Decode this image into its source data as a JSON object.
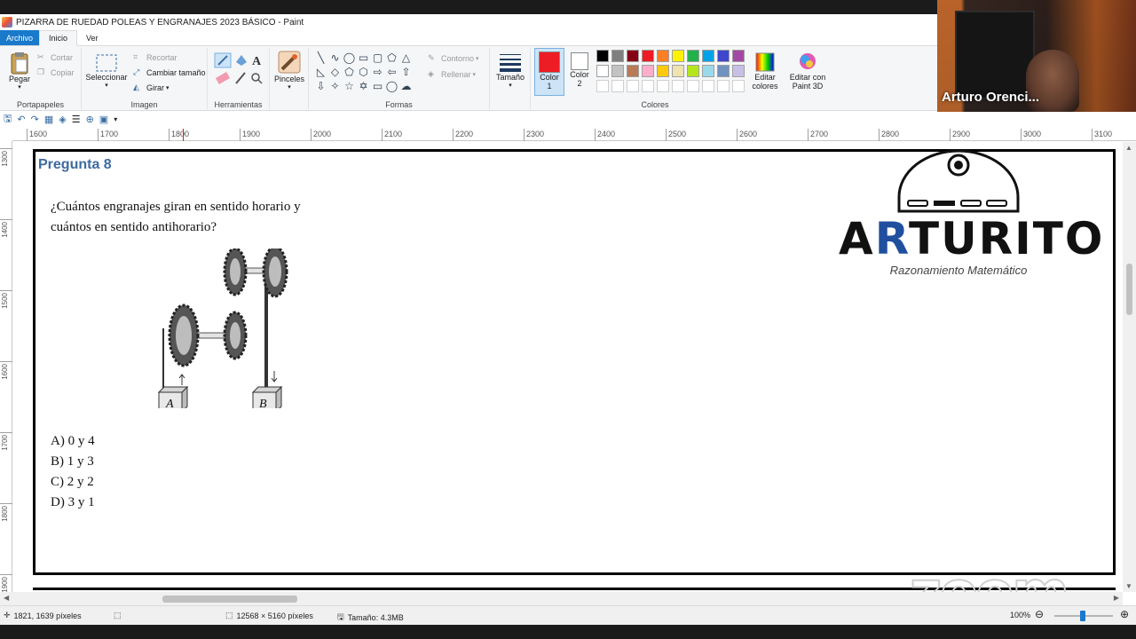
{
  "window": {
    "title": "PIZARRA DE RUEDAD POLEAS  Y ENGRANAJES 2023 BÁSICO - Paint"
  },
  "menu": {
    "file": "Archivo",
    "tabs": [
      "Inicio",
      "Ver"
    ]
  },
  "ribbon": {
    "clipboard": {
      "label": "Portapapeles",
      "paste": "Pegar",
      "cut": "Cortar",
      "copy": "Copiar"
    },
    "image": {
      "label": "Imagen",
      "select": "Seleccionar",
      "crop": "Recortar",
      "resize": "Cambiar tamaño",
      "rotate": "Girar"
    },
    "tools": {
      "label": "Herramientas"
    },
    "brushes": {
      "label": "Pinceles"
    },
    "shapes": {
      "label": "Formas",
      "outline": "Contorno",
      "fill": "Rellenar"
    },
    "size": {
      "label": "Tamaño"
    },
    "colors": {
      "label": "Colores",
      "color1": "Color 1",
      "color2": "Color 2",
      "color1_value": "#ee1c24",
      "color2_value": "#ffffff",
      "edit": "Editar colores",
      "edit3d": "Editar con Paint 3D",
      "palette_row1": [
        "#000000",
        "#7f7f7f",
        "#880015",
        "#ed1c24",
        "#ff7f27",
        "#fff200",
        "#22b14c",
        "#00a2e8",
        "#3f48cc",
        "#a349a4"
      ],
      "palette_row2": [
        "#ffffff",
        "#c3c3c3",
        "#b97a57",
        "#ffaec9",
        "#ffc90e",
        "#efe4b0",
        "#b5e61d",
        "#99d9ea",
        "#7092be",
        "#c8bfe7"
      ]
    }
  },
  "ruler": {
    "h_ticks": [
      "1600",
      "1700",
      "1800",
      "1900",
      "2000",
      "2100",
      "2200",
      "2300",
      "2400",
      "2500",
      "2600",
      "2700",
      "2800",
      "2900",
      "3000",
      "3100"
    ],
    "v_ticks": [
      "1300",
      "1400",
      "1500",
      "1600",
      "1700",
      "1800",
      "1900"
    ]
  },
  "content": {
    "question_title": "Pregunta 8",
    "question_line1": "¿Cuántos engranajes giran en sentido horario y",
    "question_line2": "cuántos en sentido antihorario?",
    "block_a": "A",
    "block_b": "B",
    "options": [
      "A)  0 y 4",
      "B)  1 y 3",
      "C)  2 y 2",
      "D)  3 y 1"
    ]
  },
  "logo": {
    "word_pre": "A",
    "word_r": "R",
    "word_post": "TURITO",
    "subtitle": "Razonamiento Matemático"
  },
  "watermark": {
    "text": "zoom"
  },
  "webcam": {
    "name": "Arturo Orenci..."
  },
  "status": {
    "cursor": "1821, 1639 píxeles",
    "dimensions": "12568 × 5160 píxeles",
    "size": "Tamaño: 4.3MB",
    "zoom": "100%"
  }
}
